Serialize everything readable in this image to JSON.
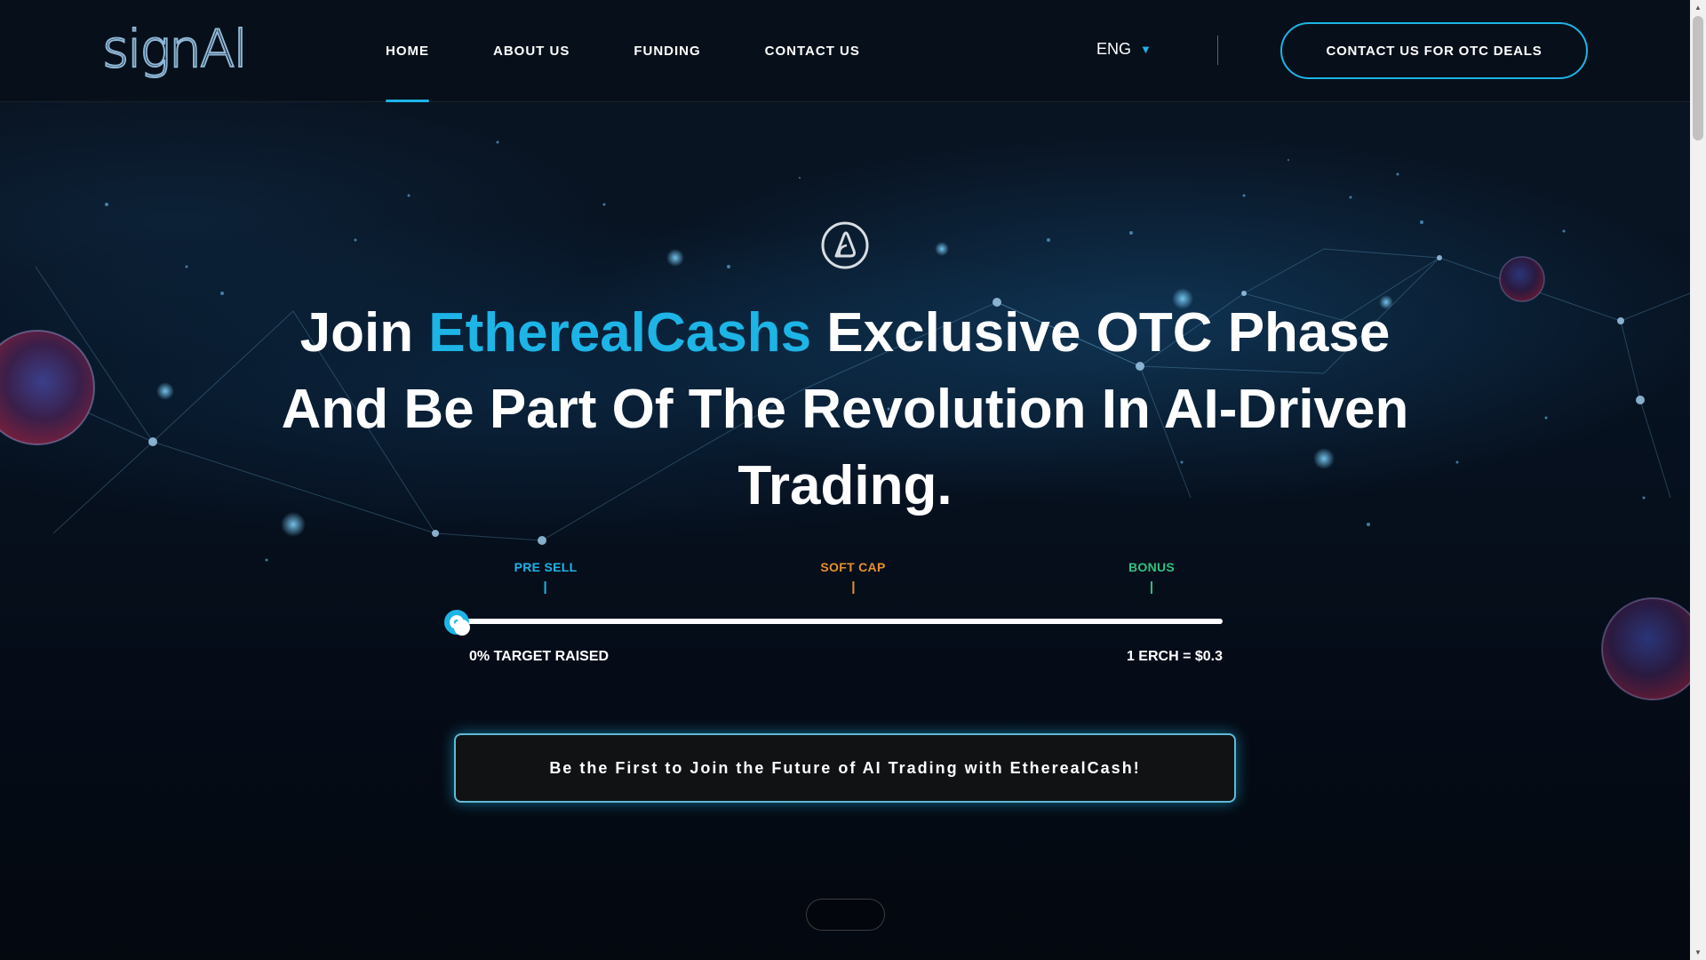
{
  "header": {
    "logo_text": "signAl",
    "nav": [
      {
        "label": "HOME",
        "active": true
      },
      {
        "label": "ABOUT US",
        "active": false
      },
      {
        "label": "FUNDING",
        "active": false
      },
      {
        "label": "CONTACT US",
        "active": false
      }
    ],
    "language": "ENG",
    "otc_button": "CONTACT US FOR OTC DEALS"
  },
  "hero": {
    "icon": "signal-a-logo-icon",
    "headline_part1": "Join ",
    "headline_accent": "EtherealCashs",
    "headline_part2": " Exclusive OTC Phase And Be Part Of The Revolution In AI-Driven Trading."
  },
  "progress": {
    "markers": [
      {
        "label": "PRE SELL",
        "color": "#1db4e6"
      },
      {
        "label": "SOFT CAP",
        "color": "#e8902a"
      },
      {
        "label": "BONUS",
        "color": "#2ec27e"
      }
    ],
    "raised_percent": 0,
    "raised_label": "0% TARGET RAISED",
    "rate_label": "1 ERCH = $0.3"
  },
  "cta": {
    "label": "Be the First to Join the Future of AI Trading with EtherealCash!"
  },
  "colors": {
    "accent": "#1db4e6",
    "background": "#050b14",
    "cta_bg": "#111214"
  }
}
